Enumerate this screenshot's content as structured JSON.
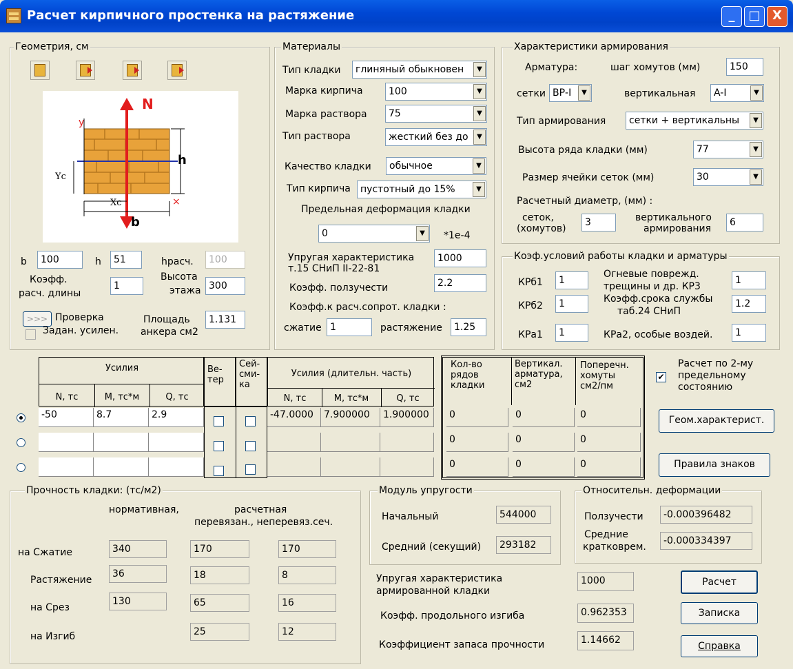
{
  "window": {
    "title": "Расчет кирпичного простенка на растяжение",
    "min": "_",
    "max": "□",
    "close": "X"
  },
  "geometry": {
    "legend": "Геометрия, см",
    "b_label": "b",
    "b": "100",
    "h_label": "h",
    "h": "51",
    "hcalc_label": "hрасч.",
    "hcalc": "100",
    "koef_label1": "Коэфф.",
    "koef_label2": "расч. длины",
    "koef": "1",
    "floor_label1": "Высота",
    "floor_label2": "этажа",
    "floor": "300",
    "arrow_btn": ">>>",
    "check_label": "Проверка",
    "reinforce_label": "Задан. усилен.",
    "area_label1": "Площадь",
    "area_label2": "анкера см2",
    "area": "1.131",
    "diag": {
      "N": "N",
      "y": "y",
      "h": "h",
      "b": "b",
      "Yc": "Yc",
      "Xc": "Xc"
    }
  },
  "materials": {
    "legend": "Материалы",
    "masonry_type_label": "Тип кладки",
    "masonry_type": "глиняный обыкновен",
    "brick_grade_label": "Марка кирпича",
    "brick_grade": "100",
    "mortar_grade_label": "Марка раствора",
    "mortar_grade": "75",
    "mortar_type_label": "Тип раствора",
    "mortar_type": "жесткий без до",
    "quality_label": "Качество кладки",
    "quality": "обычное",
    "brick_type_label": "Тип кирпича",
    "brick_type": "пустотный до 15%",
    "limit_def_label": "Предельная деформация кладки",
    "limit_def": "0",
    "limit_unit": "*1e-4",
    "elastic_label1": "Упругая характеристика",
    "elastic_label2": "т.15 СНиП II-22-81",
    "elastic": "1000",
    "creep_label": "Коэфф. ползучести",
    "creep": "2.2",
    "resist_label": "Коэфф.к расч.сопрот. кладки :",
    "compress_label": "сжатие",
    "compress": "1",
    "tension_label": "растяжение",
    "tension": "1.25"
  },
  "reinforcement": {
    "legend": "Характеристики армирования",
    "rebar_label": "Арматура:",
    "stirrup_label": "шаг хомутов (мм)",
    "stirrup": "150",
    "mesh_label": "сетки",
    "mesh": "ВР-I",
    "vert_label": "вертикальная",
    "vert": "A-I",
    "type_label": "Тип армирования",
    "type": "сетки + вертикальны",
    "row_h_label": "Высота ряда кладки (мм)",
    "row_h": "77",
    "cell_label": "Размер ячейки сеток (мм)",
    "cell": "30",
    "diam_label": "Расчетный диаметр, (мм) :",
    "mesh_d_label1": "сеток,",
    "mesh_d_label2": "(хомутов)",
    "mesh_d": "3",
    "vert_d_label1": "вертикального",
    "vert_d_label2": "армирования",
    "vert_d": "6"
  },
  "coefs": {
    "legend": "Коэф.условий работы кладки и арматуры",
    "kp1_label": "КРб1",
    "kp1": "1",
    "fire_label1": "Огневые поврежд.",
    "fire_label2": "трещины и др. КР3",
    "fire": "1",
    "kp2_label": "КРб2",
    "kp2": "1",
    "life_label1": "Коэфф.срока службы",
    "life_label2": "таб.24 СНиП",
    "life": "1.2",
    "kpa1_label": "КРа1",
    "kpa1": "1",
    "kpa2_label": "КРа2, особые воздей.",
    "kpa2": "1"
  },
  "loads": {
    "h_forces": "Усилия",
    "h_N": "N, тс",
    "h_M": "M, тс*м",
    "h_Q": "Q, тс",
    "h_wind": "Ве-\nтер",
    "h_seis": "Сей-\nсми-\nка",
    "h_long": "Усилия (длительн. часть)",
    "rows": [
      {
        "N": "-50",
        "M": "8.7",
        "Q": "2.9",
        "lN": "-47.0000",
        "lM": "7.900000",
        "lQ": "1.900000"
      },
      {
        "N": "",
        "M": "",
        "Q": "",
        "lN": "",
        "lM": "",
        "lQ": ""
      },
      {
        "N": "",
        "M": "",
        "Q": "",
        "lN": "",
        "lM": "",
        "lQ": ""
      }
    ]
  },
  "results_table": {
    "h_rows": "Кол-во\nрядов\nкладки",
    "h_vert": "Вертикал.\nарматура,\nсм2",
    "h_hor": "Поперечн.\nхомуты\nсм2/пм",
    "rows": [
      {
        "rows": "0",
        "vert": "0",
        "hor": "0"
      },
      {
        "rows": "0",
        "vert": "0",
        "hor": "0"
      },
      {
        "rows": "0",
        "vert": "0",
        "hor": "0"
      }
    ]
  },
  "limit_state": {
    "label": "Расчет по 2-му\nпредельному\nсостоянию",
    "checked": "✔"
  },
  "buttons": {
    "geom": "Геом.характерист.",
    "signs": "Правила знаков",
    "calc": "Расчет",
    "note": "Записка",
    "help": "Справка"
  },
  "strength": {
    "legend": "Прочность кладки:  (тс/м2)",
    "col1": "нормативная,",
    "col2": "расчетная",
    "col3": "перевязан., неперевяз.сеч.",
    "rows": [
      {
        "label": "на Сжатие",
        "n": "340",
        "r1": "170",
        "r2": "170"
      },
      {
        "label": "Растяжение",
        "n": "36",
        "r1": "18",
        "r2": "8"
      },
      {
        "label": "на Срез",
        "n": "130",
        "r1": "65",
        "r2": "16"
      },
      {
        "label": "на Изгиб",
        "n": "",
        "r1": "25",
        "r2": "12"
      }
    ]
  },
  "modulus": {
    "legend": "Модуль упругости",
    "initial_label": "Начальный",
    "initial": "544000",
    "mean_label": "Средний (секущий)",
    "mean": "293182"
  },
  "deform": {
    "legend": "Относительн. деформации",
    "creep_label": "Ползучести",
    "creep": "-0.000396482",
    "short_label1": "Средние",
    "short_label2": "кратковрем.",
    "short": "-0.000334397"
  },
  "summary": {
    "elastic_label1": "Упругая характеристика",
    "elastic_label2": "армированной кладки",
    "elastic": "1000",
    "buckling_label": "Коэфф. продольного изгиба",
    "buckling": "0.962353",
    "safety_label": "Коэффициент  запаса  прочности",
    "safety": "1.14662"
  }
}
